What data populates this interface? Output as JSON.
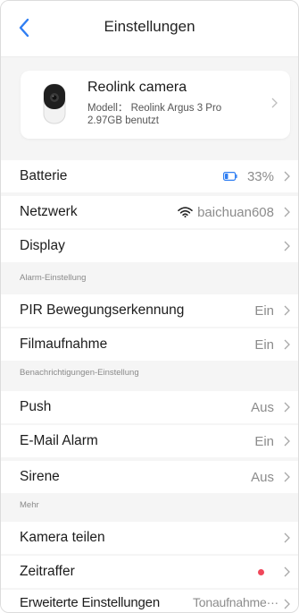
{
  "header": {
    "title": "Einstellungen"
  },
  "device": {
    "name": "Reolink camera",
    "model": "Modell： Reolink Argus 3 Pro",
    "storage": "2.97GB benutzt"
  },
  "rows": {
    "battery": {
      "label": "Batterie",
      "value": "33%",
      "level_percent": 33
    },
    "network": {
      "label": "Netzwerk",
      "value": "baichuan608"
    },
    "display": {
      "label": "Display"
    },
    "pir": {
      "label": "PIR Bewegungserkennung",
      "value": "Ein"
    },
    "recording": {
      "label": "Filmaufnahme",
      "value": "Ein"
    },
    "push": {
      "label": "Push",
      "value": "Aus"
    },
    "email": {
      "label": "E-Mail Alarm",
      "value": "Ein"
    },
    "siren": {
      "label": "Sirene",
      "value": "Aus"
    },
    "share": {
      "label": "Kamera teilen"
    },
    "timelapse": {
      "label": "Zeitraffer"
    },
    "advanced": {
      "label": "Erweiterte Einstellungen",
      "value": "Tonaufnahme···"
    }
  },
  "sections": {
    "alarm": "Alarm-Einstellung",
    "notifications": "Benachrichtigungen-Einstellung",
    "more": "Mehr"
  },
  "colors": {
    "accent": "#2f7ef2",
    "badge_red": "#f0475a",
    "background": "#f5f5f5",
    "value_gray": "#8c8c8c"
  },
  "icons": {
    "back": "chevron-left-icon",
    "chevron": "chevron-right-icon",
    "battery": "battery-icon",
    "wifi": "wifi-icon",
    "camera": "camera-icon"
  }
}
